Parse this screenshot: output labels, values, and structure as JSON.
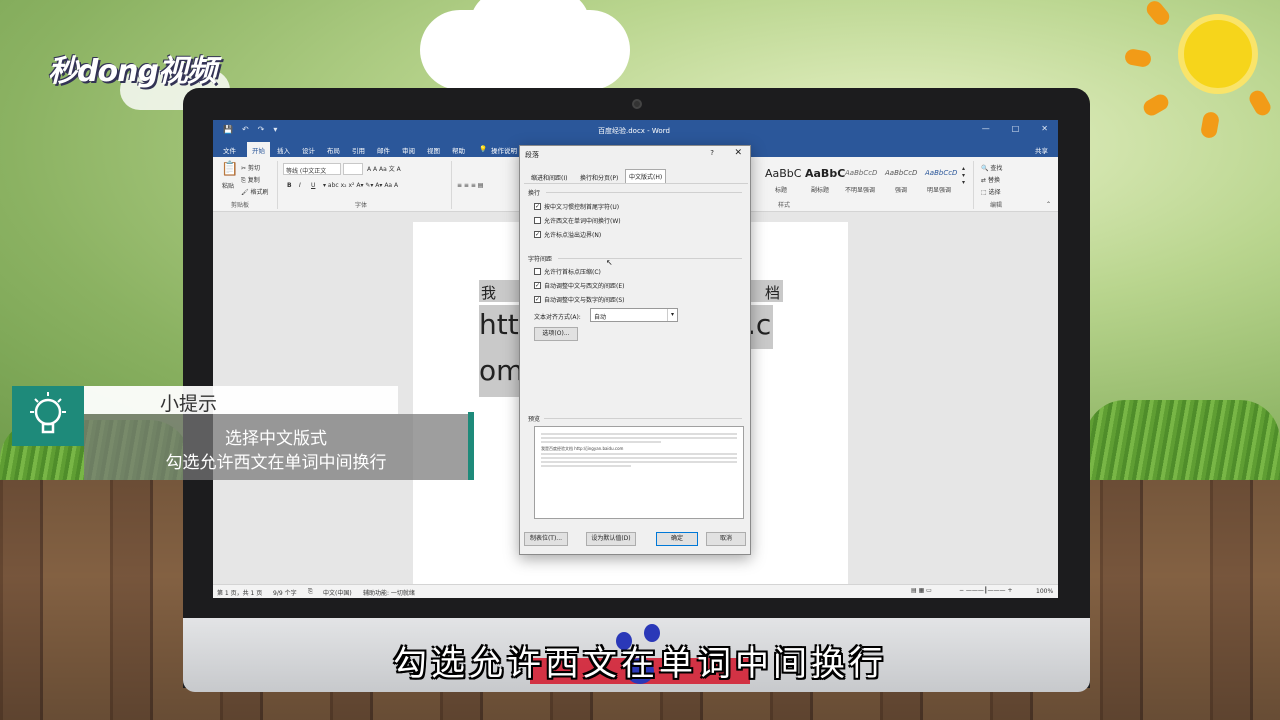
{
  "brand": {
    "logo_text": "秒dong视频"
  },
  "word": {
    "doc_title": "百度经验.docx - Word",
    "quick_access": [
      "💾",
      "↶",
      "↷",
      "▾"
    ],
    "window_controls": [
      "—",
      "□",
      "✕"
    ],
    "menu_tabs": [
      "文件",
      "开始",
      "插入",
      "设计",
      "布局",
      "引用",
      "邮件",
      "审阅",
      "视图",
      "帮助",
      "操作说明"
    ],
    "share": "共享",
    "ribbon": {
      "clipboard": {
        "paste": "粘贴",
        "cut": "剪切",
        "copy": "复制",
        "format_painter": "格式刷",
        "group_label": "剪贴板"
      },
      "font": {
        "font_name": "等线 (中文正文",
        "group_label": "字体",
        "bold": "B",
        "italic": "I",
        "underline": "U"
      },
      "styles": {
        "samples": [
          "AaBbC",
          "AaBbC",
          "AaBbCcD",
          "AaBbCcD",
          "AaBbCcD"
        ],
        "names": [
          "标题",
          "副标题",
          "不明显强调",
          "强调",
          "明显强调"
        ],
        "group_label": "样式"
      },
      "editing": {
        "find": "查找",
        "replace": "替换",
        "select": "选择",
        "group_label": "编辑"
      }
    },
    "document": {
      "char1": "我",
      "char2": "档",
      "line2": "http",
      "line2_end": ".c",
      "line3": "om"
    },
    "status": {
      "page": "第 1 页，共 1 页",
      "words": "9/9 个字",
      "lang": "中文(中国)",
      "accessibility": "辅助功能: 一切就绪",
      "zoom": "100%"
    }
  },
  "dialog": {
    "title": "段落",
    "help": "?",
    "close": "✕",
    "tabs": [
      "缩进和间距(I)",
      "换行和分页(P)",
      "中文版式(H)"
    ],
    "active_tab": 2,
    "section_wrap": "换行",
    "wrap_options": [
      {
        "label": "按中文习惯控制首尾字符(U)",
        "checked": true
      },
      {
        "label": "允许西文在单词中间换行(W)",
        "checked": false
      },
      {
        "label": "允许标点溢出边界(N)",
        "checked": true
      }
    ],
    "section_spacing": "字符间距",
    "spacing_options": [
      {
        "label": "允许行首标点压缩(C)",
        "checked": false
      },
      {
        "label": "自动调整中文与西文的间距(E)",
        "checked": true
      },
      {
        "label": "自动调整中文与数字的间距(S)",
        "checked": true
      }
    ],
    "align_label": "文本对齐方式(A):",
    "align_value": "自动",
    "options_button": "选项(O)...",
    "preview_label": "预览",
    "preview_sample": "我是百度经验文档 http://jingyan.baidu.com",
    "buttons": {
      "tabs": "制表位(T)...",
      "set_default": "设为默认值(D)",
      "ok": "确定",
      "cancel": "取消"
    }
  },
  "tip": {
    "title": "小提示",
    "line1": "选择中文版式",
    "line2": "勾选允许西文在单词中间换行"
  },
  "subtitle": "勾选允许西文在单词中间换行",
  "colors": {
    "word_blue": "#2b579a",
    "tip_green": "#1e8a7a",
    "watermark_red": "#d4162b"
  }
}
